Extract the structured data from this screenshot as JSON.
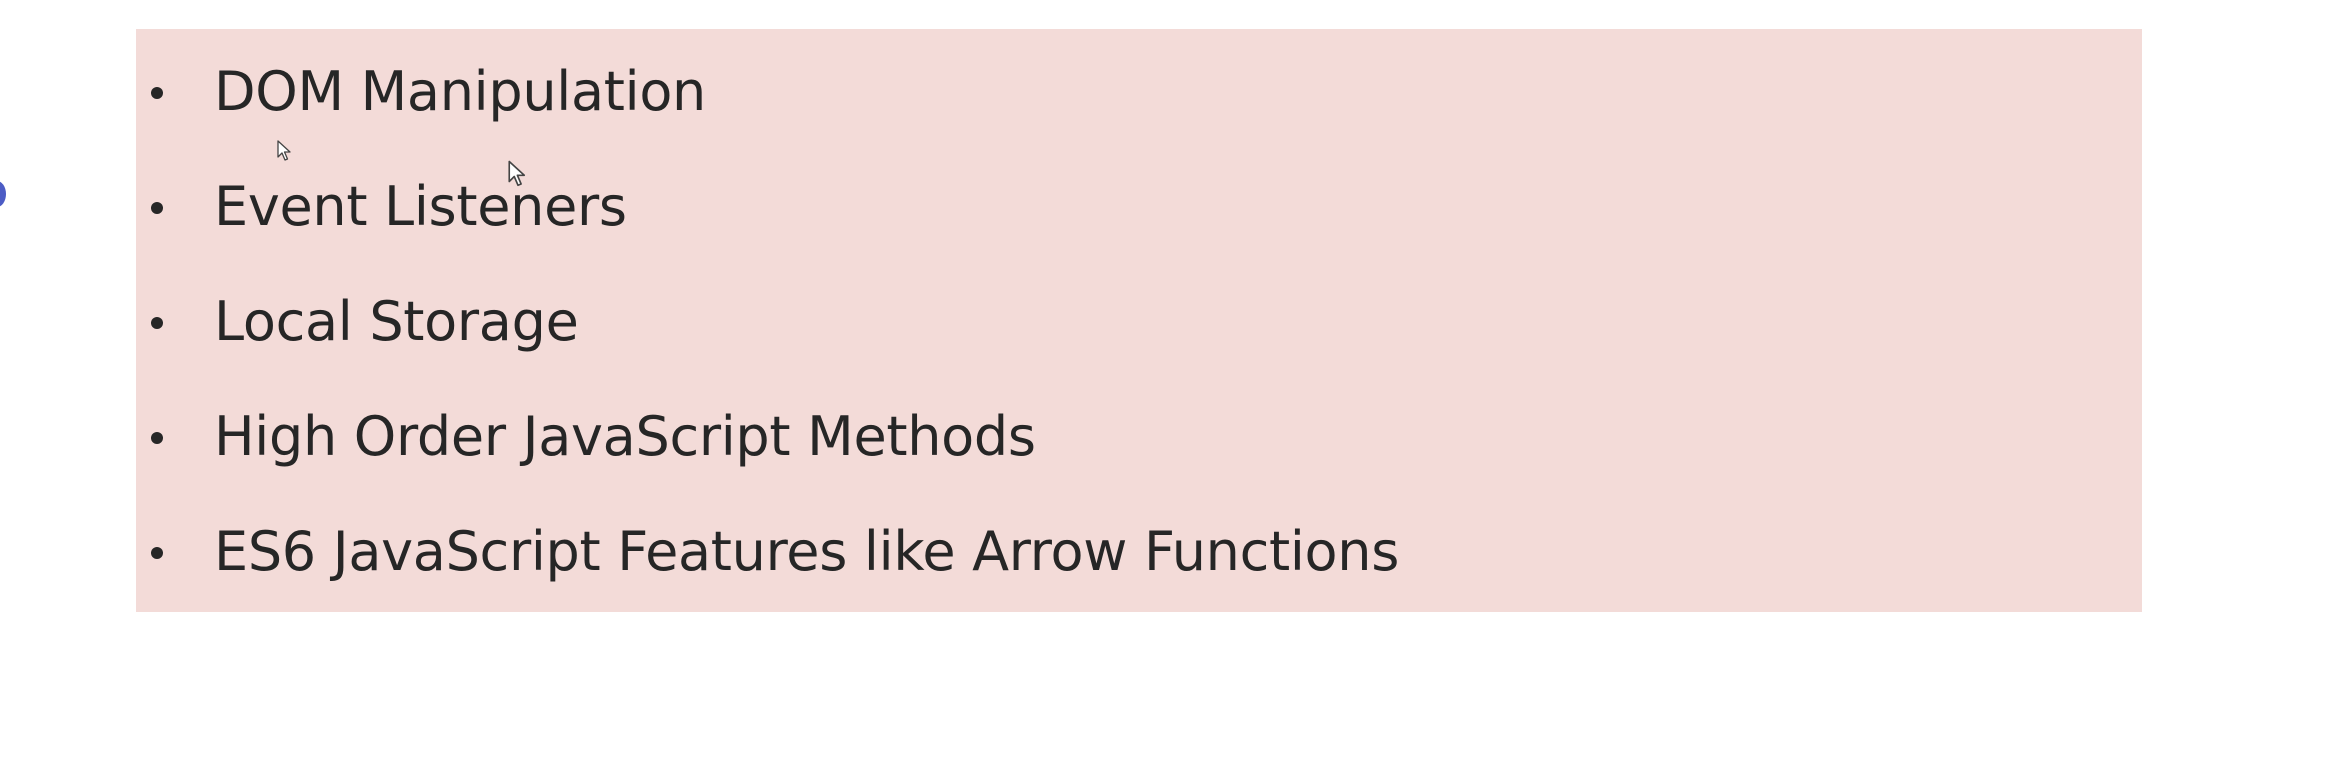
{
  "slide": {
    "bullets": [
      {
        "label": "DOM Manipulation"
      },
      {
        "label": "Event Listeners"
      },
      {
        "label": "Local Storage"
      },
      {
        "label": "High Order JavaScript Methods"
      },
      {
        "label": "ES6 JavaScript Features like Arrow Functions"
      }
    ]
  },
  "colors": {
    "panel_background": "#f3dbd8",
    "text": "#262626",
    "edge_mark": "#4c5cc5"
  },
  "icons": [
    "arrow-cursor-icon",
    "arrow-cursor-icon"
  ]
}
